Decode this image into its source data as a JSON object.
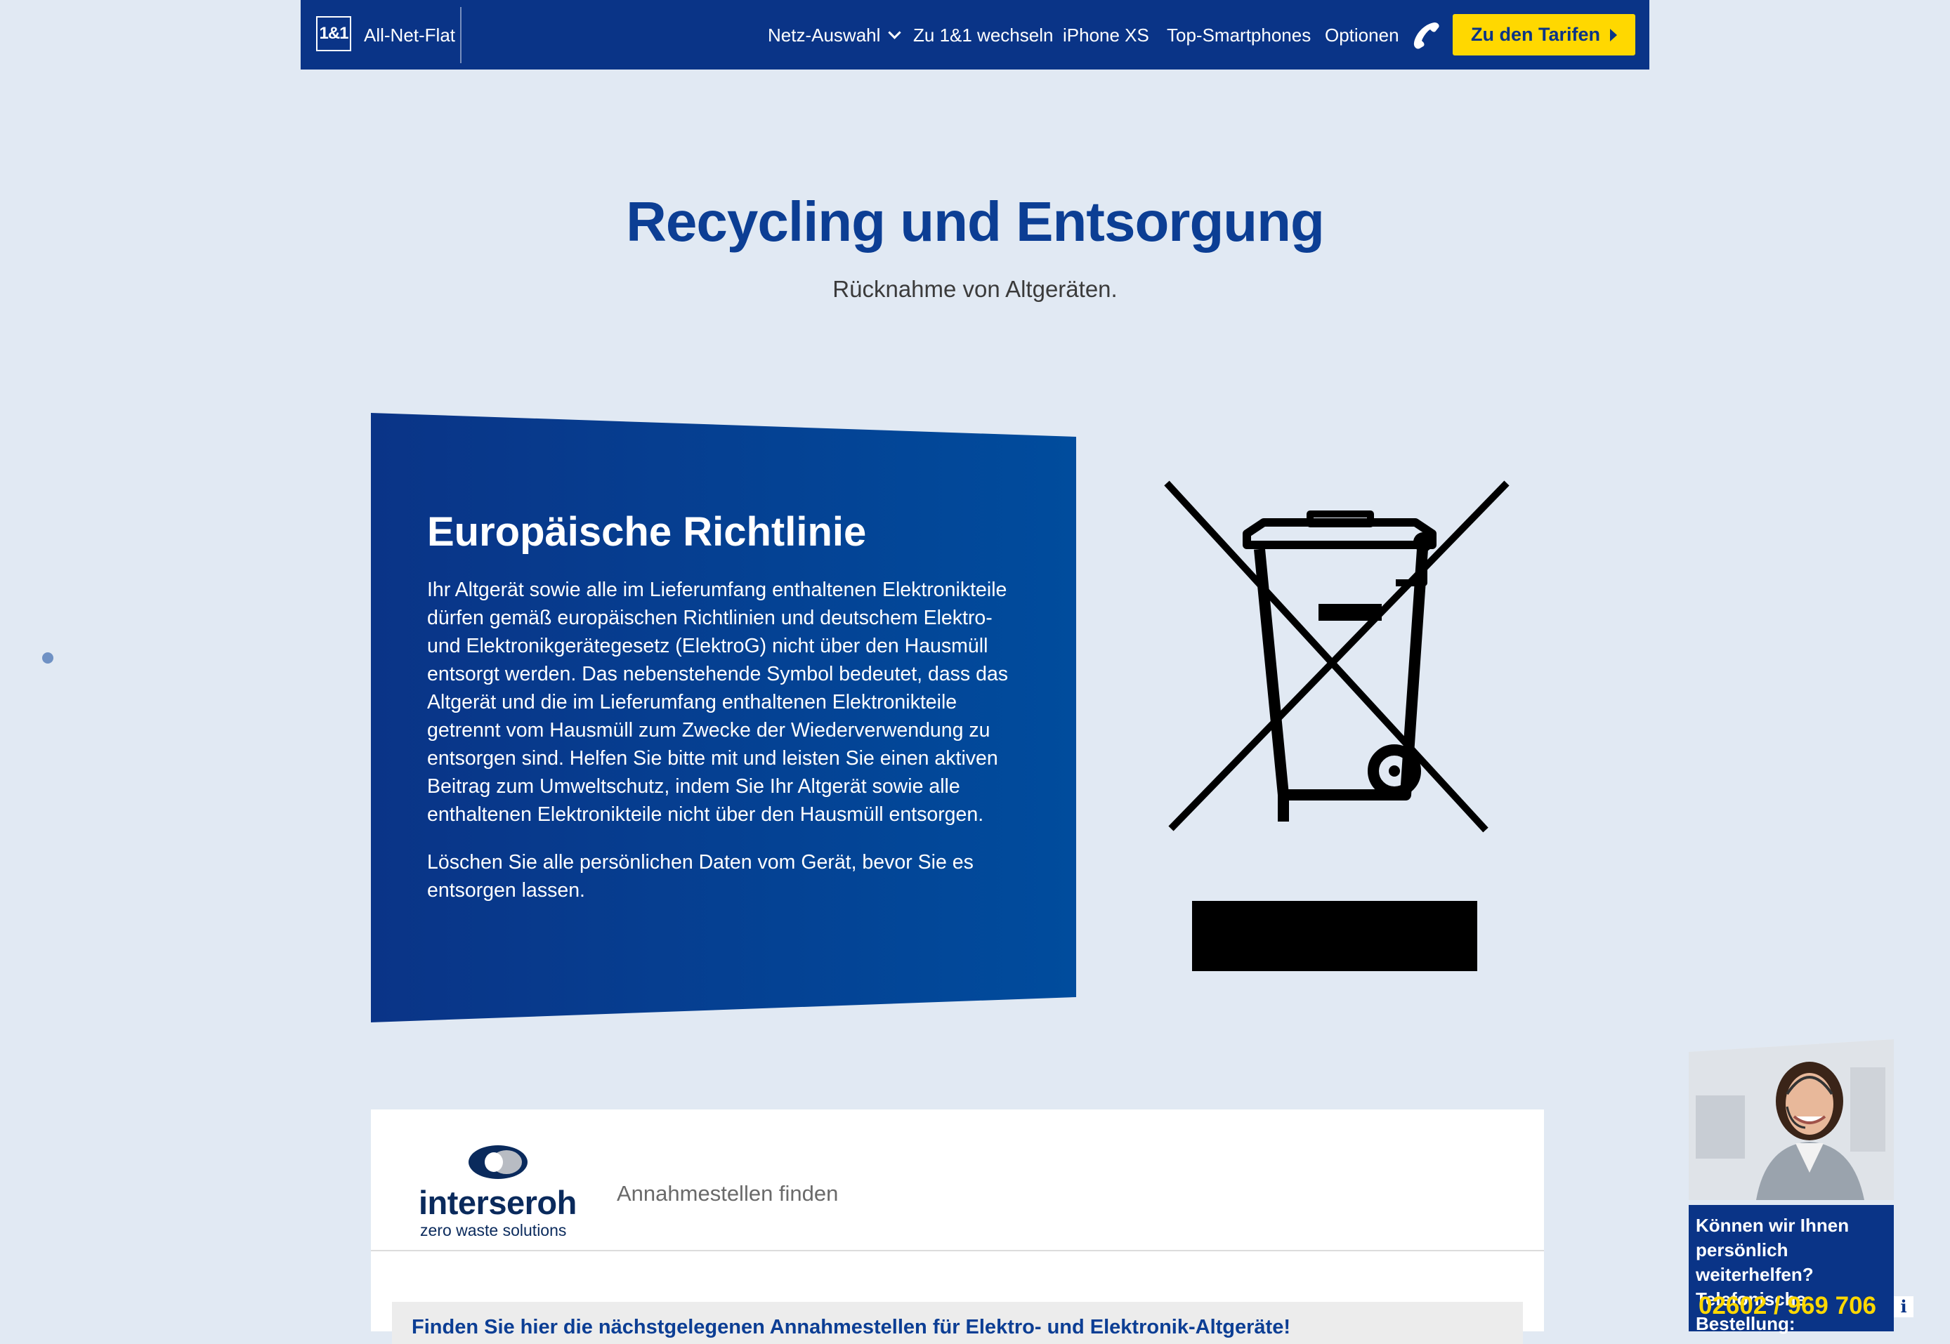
{
  "nav": {
    "brand_logo": "1&1",
    "brand_name": "All-Net-Flat",
    "items": [
      {
        "label": "Netz-Auswahl"
      },
      {
        "label": "Zu 1&1 wechseln"
      },
      {
        "label": "iPhone XS"
      },
      {
        "label": "Top-Smartphones"
      },
      {
        "label": "Optionen"
      }
    ],
    "phone_icon": "phone-icon",
    "cta_label": "Zu den Tarifen"
  },
  "hero": {
    "title": "Recycling und Entsorgung",
    "subtitle": "Rücknahme von Altgeräten."
  },
  "panel": {
    "title": "Europäische Richtlinie",
    "paragraph1": "Ihr Altgerät sowie alle im Lieferumfang enthaltenen Elektronikteile dürfen gemäß europäischen Richtlinien und deutschem Elektro- und Elektronikgerätegesetz (ElektroG) nicht über den Hausmüll entsorgt werden. Das nebenstehende Symbol bedeutet, dass das Altgerät und die im Lieferumfang enthaltenen Elektronikteile getrennt vom Hausmüll zum Zwecke der Wiederverwendung zu entsorgen sind. Helfen Sie bitte mit und leisten Sie einen aktiven Beitrag zum Umweltschutz, indem Sie Ihr Altgerät sowie alle enthaltenen Elektronikteile nicht über den Hausmüll entsorgen.",
    "paragraph2": "Löschen Sie alle persönlichen Daten vom Gerät, bevor Sie es entsorgen lassen."
  },
  "symbol": {
    "icon": "crossed-out-wheelie-bin-icon"
  },
  "finder": {
    "brand_name": "interseroh",
    "brand_claim": "zero waste solutions",
    "tab_label": "Annahmestellen finden",
    "notice": "Finden Sie hier die nächstgelegenen Annahmestellen für Elektro- und Elektronik-Altgeräte!"
  },
  "support": {
    "question": "Können wir Ihnen persönlich weiterhelfen? Telefonische Bestellung:",
    "phone": "02602 / 969 706",
    "info_icon": "i"
  },
  "colors": {
    "brand_blue": "#0a3487",
    "title_blue": "#0c3e94",
    "cta_yellow": "#ffd800",
    "page_bg": "#e1e9f3"
  }
}
